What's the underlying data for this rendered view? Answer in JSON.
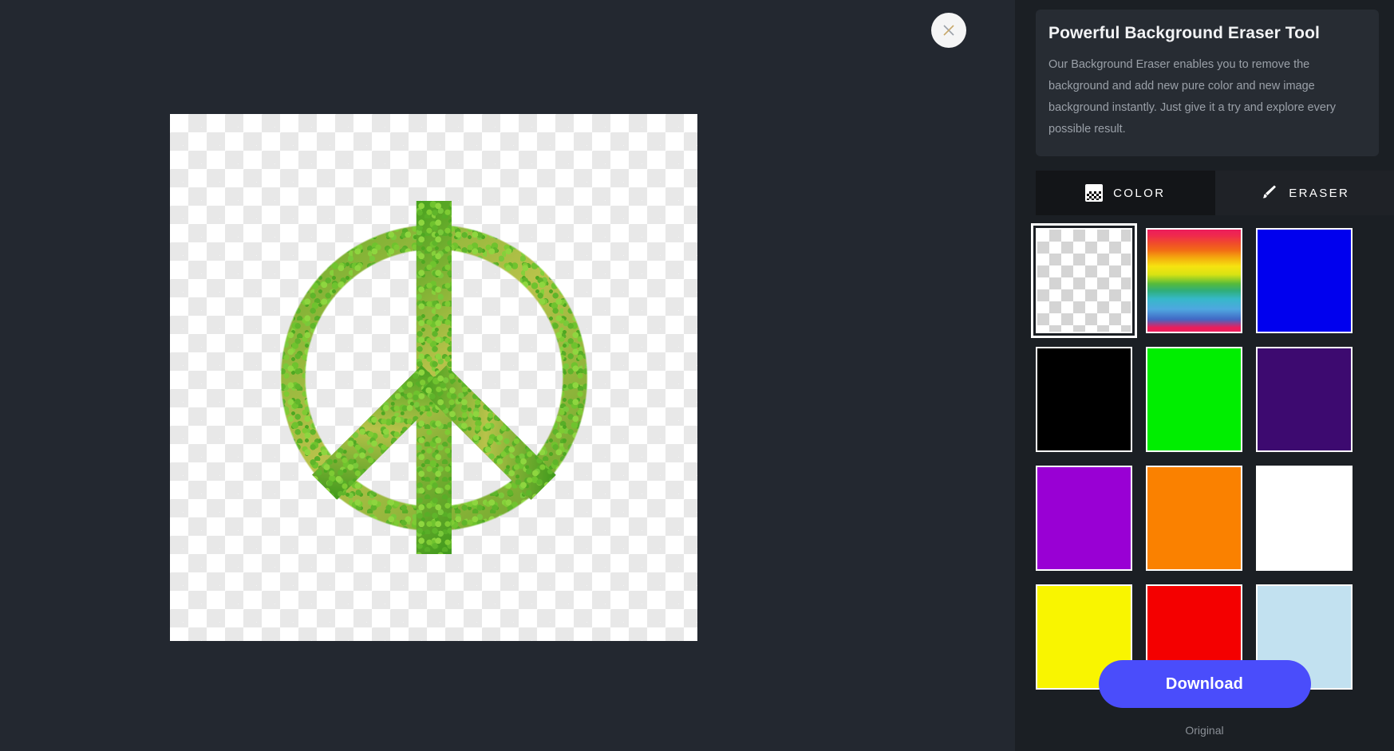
{
  "app": {
    "background_color": "#232830",
    "panel_color": "#1b1f24"
  },
  "canvas": {
    "close_icon": "close-icon",
    "image_description": "Peace sign made of green peas on transparent checkerboard background",
    "transparency_checker": true
  },
  "info_card": {
    "title": "Powerful Background Eraser Tool",
    "description": "Our Background Eraser enables you to remove the background and add new pure color and new image background instantly. Just give it a try and explore every possible result."
  },
  "tabs": [
    {
      "label": "COLOR",
      "icon": "checkerboard-icon",
      "active": true
    },
    {
      "label": "ERASER",
      "icon": "brush-icon",
      "active": false
    }
  ],
  "swatches": [
    {
      "name": "transparent",
      "type": "transparent",
      "color": "",
      "selected": true
    },
    {
      "name": "rainbow",
      "type": "gradient",
      "color": "",
      "selected": false
    },
    {
      "name": "blue",
      "type": "solid",
      "color": "#0000ee",
      "selected": false
    },
    {
      "name": "black",
      "type": "solid",
      "color": "#000000",
      "selected": false
    },
    {
      "name": "green",
      "type": "solid",
      "color": "#00ee00",
      "selected": false
    },
    {
      "name": "dark-purple",
      "type": "solid",
      "color": "#3d0a70",
      "selected": false
    },
    {
      "name": "purple",
      "type": "solid",
      "color": "#9900d4",
      "selected": false
    },
    {
      "name": "orange",
      "type": "solid",
      "color": "#fa8100",
      "selected": false
    },
    {
      "name": "white",
      "type": "solid",
      "color": "#ffffff",
      "selected": false
    },
    {
      "name": "yellow",
      "type": "solid",
      "color": "#f9f500",
      "selected": false
    },
    {
      "name": "red",
      "type": "solid",
      "color": "#f40000",
      "selected": false
    },
    {
      "name": "light-blue",
      "type": "solid",
      "color": "#c2e1f0",
      "selected": false
    }
  ],
  "scrollbar": {
    "up_arrow": "chevron-up-icon",
    "down_arrow": "chevron-down-icon",
    "thumb_position_pct": 5,
    "thumb_size_pct": 38
  },
  "footer": {
    "download_label": "Download",
    "download_color": "#4a4dfb",
    "status_label": "Original"
  }
}
